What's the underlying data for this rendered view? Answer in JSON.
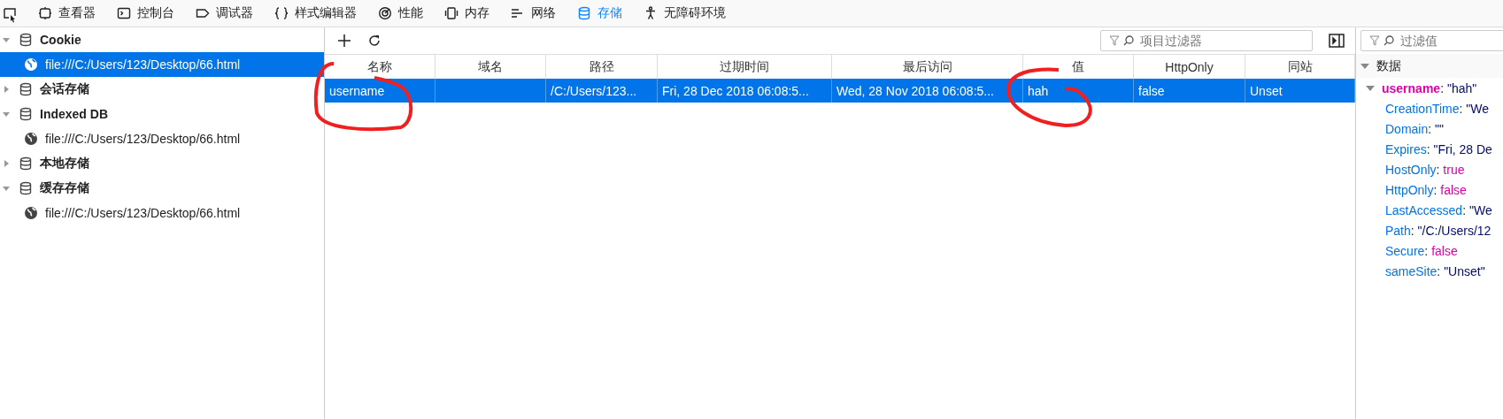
{
  "tabs": [
    {
      "label": "查看器",
      "selected": false
    },
    {
      "label": "控制台",
      "selected": false
    },
    {
      "label": "调试器",
      "selected": false
    },
    {
      "label": "样式编辑器",
      "selected": false
    },
    {
      "label": "性能",
      "selected": false
    },
    {
      "label": "内存",
      "selected": false
    },
    {
      "label": "网络",
      "selected": false
    },
    {
      "label": "存储",
      "selected": true
    },
    {
      "label": "无障碍环境",
      "selected": false
    }
  ],
  "sidebar": {
    "items": [
      {
        "label": "Cookie",
        "expanded": true,
        "selected": false,
        "children": [
          {
            "label": "file:///C:/Users/123/Desktop/66.html",
            "selected": true
          }
        ]
      },
      {
        "label": "会话存储",
        "expanded": false,
        "selected": false
      },
      {
        "label": "Indexed DB",
        "expanded": true,
        "selected": false,
        "children": [
          {
            "label": "file:///C:/Users/123/Desktop/66.html",
            "selected": false
          }
        ]
      },
      {
        "label": "本地存储",
        "expanded": false,
        "selected": false
      },
      {
        "label": "缓存存储",
        "expanded": true,
        "selected": false,
        "children": [
          {
            "label": "file:///C:/Users/123/Desktop/66.html",
            "selected": false
          }
        ]
      }
    ]
  },
  "filter": {
    "placeholder": "项目过滤器"
  },
  "table": {
    "columns": [
      "名称",
      "域名",
      "路径",
      "过期时间",
      "最后访问",
      "值",
      "HttpOnly",
      "同站"
    ],
    "rows": [
      {
        "selected": true,
        "cells": [
          "username",
          "",
          "/C:/Users/123...",
          "Fri, 28 Dec 2018 06:08:5...",
          "Wed, 28 Nov 2018 06:08:5...",
          "hah",
          "false",
          "Unset"
        ]
      }
    ]
  },
  "details": {
    "filter_placeholder": "过滤值",
    "section": "数据",
    "expanded": true,
    "root": {
      "key": "username",
      "separator": ":",
      "value": "\"hah\"",
      "expanded": true
    },
    "properties": [
      {
        "key": "CreationTime",
        "separator": ":",
        "value": "\"We",
        "kind": "string"
      },
      {
        "key": "Domain",
        "separator": ":",
        "value": "\"\"",
        "kind": "string"
      },
      {
        "key": "Expires",
        "separator": ":",
        "value": "\"Fri, 28 De",
        "kind": "string"
      },
      {
        "key": "HostOnly",
        "separator": ":",
        "value": "true",
        "kind": "boolean"
      },
      {
        "key": "HttpOnly",
        "separator": ":",
        "value": "false",
        "kind": "boolean"
      },
      {
        "key": "LastAccessed",
        "separator": ":",
        "value": "\"We",
        "kind": "string"
      },
      {
        "key": "Path",
        "separator": ":",
        "value": "\"/C:/Users/12",
        "kind": "string"
      },
      {
        "key": "Secure",
        "separator": ":",
        "value": "false",
        "kind": "boolean"
      },
      {
        "key": "sameSite",
        "separator": ":",
        "value": "\"Unset\"",
        "kind": "string"
      }
    ]
  }
}
